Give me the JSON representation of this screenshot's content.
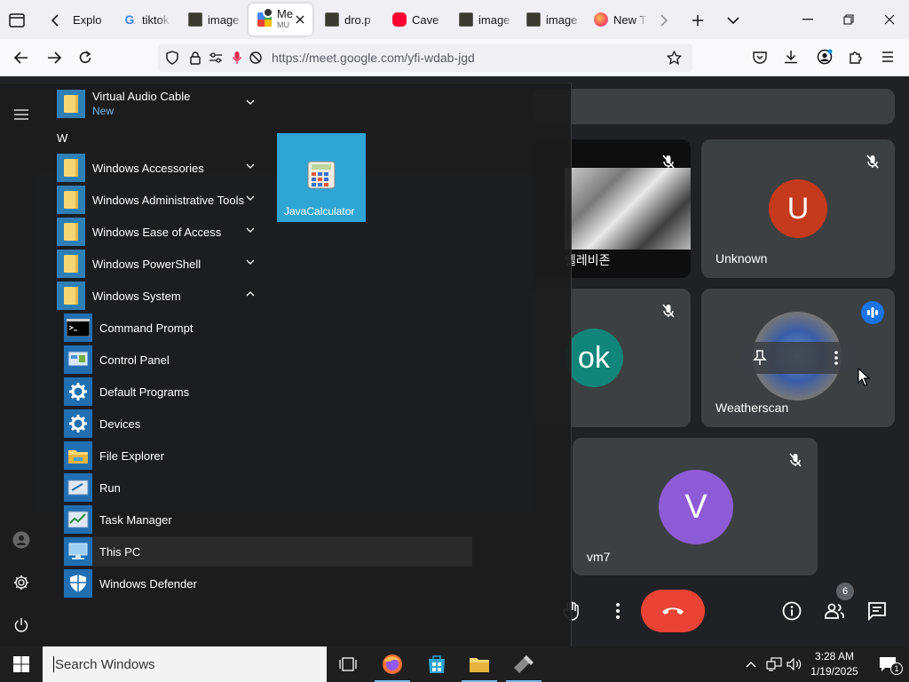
{
  "browser": {
    "tabs": [
      {
        "label": "Explo",
        "favicon": "firefox-view-icon"
      },
      {
        "label": "tiktok",
        "favicon": "google-icon"
      },
      {
        "label": "image",
        "favicon": "image-icon"
      },
      {
        "label": "Me",
        "sublabel": "MU",
        "favicon": "google-meet-icon",
        "active": true
      },
      {
        "label": "dro.p",
        "favicon": "image-icon"
      },
      {
        "label": "Cave",
        "favicon": "youtube-icon"
      },
      {
        "label": "image",
        "favicon": "image-icon"
      },
      {
        "label": "image",
        "favicon": "image-icon"
      },
      {
        "label": "New T",
        "favicon": "firefox-icon"
      }
    ],
    "url": "https://meet.google.com/yfi-wdab-jgd"
  },
  "meet": {
    "participants": [
      {
        "name": "텔레비존",
        "avatar": "",
        "muted": true,
        "video": true
      },
      {
        "name": "Unknown",
        "avatar": "U",
        "color": "#c5391d",
        "muted": true
      },
      {
        "name": "",
        "avatar": "ok",
        "color": "#12857a",
        "muted": true
      },
      {
        "name": "Weatherscan",
        "avatar": "",
        "speaking": true
      },
      {
        "name": "vm7",
        "avatar": "V",
        "color": "#8e5bd6",
        "muted": true
      }
    ],
    "people_count": "6"
  },
  "start_menu": {
    "apps": [
      {
        "label": "Virtual Audio Cable",
        "badge": "New",
        "type": "folder",
        "expand": "down"
      },
      {
        "letter": "W"
      },
      {
        "label": "Windows Accessories",
        "type": "folder",
        "expand": "down"
      },
      {
        "label": "Windows Administrative Tools",
        "type": "folder",
        "expand": "down"
      },
      {
        "label": "Windows Ease of Access",
        "type": "folder",
        "expand": "down"
      },
      {
        "label": "Windows PowerShell",
        "type": "folder",
        "expand": "down"
      },
      {
        "label": "Windows System",
        "type": "folder",
        "expand": "up"
      },
      {
        "label": "Command Prompt",
        "type": "cmd"
      },
      {
        "label": "Control Panel",
        "type": "control"
      },
      {
        "label": "Default Programs",
        "type": "gear"
      },
      {
        "label": "Devices",
        "type": "gear"
      },
      {
        "label": "File Explorer",
        "type": "explorer"
      },
      {
        "label": "Run",
        "type": "run"
      },
      {
        "label": "Task Manager",
        "type": "taskmgr"
      },
      {
        "label": "This PC",
        "type": "pc"
      },
      {
        "label": "Windows Defender",
        "type": "defender"
      }
    ],
    "pinned_tile": {
      "label": "JavaCalculator"
    }
  },
  "taskbar": {
    "search_placeholder": "Search Windows",
    "time": "3:28 AM",
    "date": "1/19/2025",
    "notification_count": "1"
  },
  "colors": {
    "accent": "#1a73e8",
    "end_call": "#ea4335",
    "start_tile": "#2ea5d4"
  }
}
